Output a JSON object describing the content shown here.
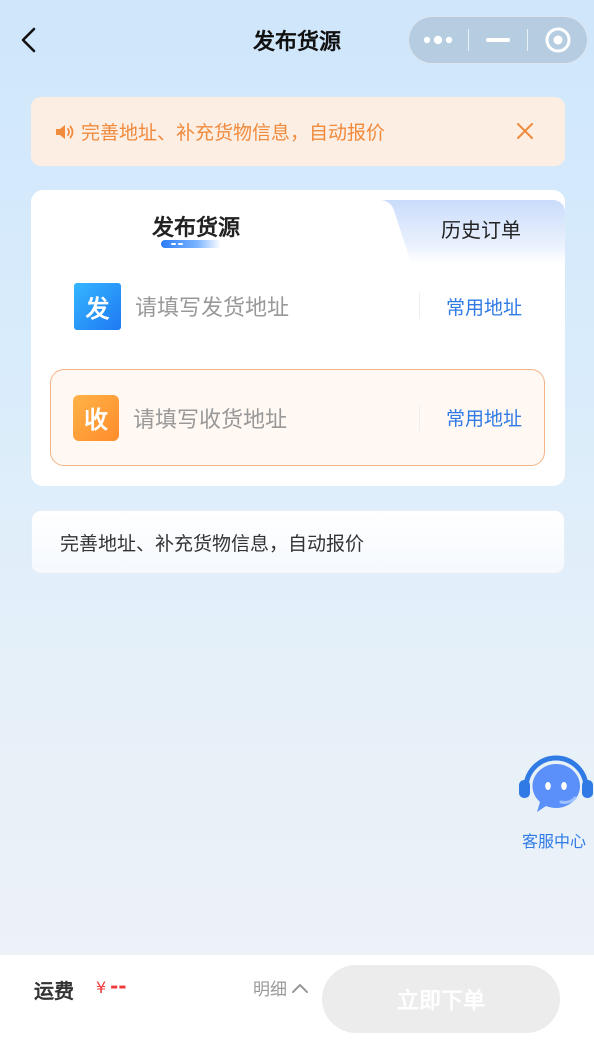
{
  "nav": {
    "title": "发布货源",
    "back_icon": "chevron-left-icon",
    "capsule_icons": [
      "more-dots-icon",
      "minimize-icon",
      "close-circle-icon"
    ]
  },
  "notice": {
    "icon": "speaker-icon",
    "text": "完善地址、补充货物信息，自动报价",
    "close_icon": "close-icon",
    "color": "#f08a3c"
  },
  "tabs": {
    "active": "发布货源",
    "other": "历史订单"
  },
  "sender": {
    "badge": "发",
    "placeholder": "请填写发货地址",
    "link": "常用地址",
    "color": "#1f79f3"
  },
  "receiver": {
    "badge": "收",
    "placeholder": "请填写收货地址",
    "link": "常用地址",
    "color": "#ff8c2b"
  },
  "tip": {
    "text": "完善地址、补充货物信息，自动报价"
  },
  "service": {
    "icon": "customer-service-icon",
    "label": "客服中心"
  },
  "bottom": {
    "fee_label": "运费",
    "currency": "¥",
    "fee_value": "--",
    "detail_label": "明细",
    "submit_label": "立即下单",
    "accent": "#f03a3a"
  }
}
